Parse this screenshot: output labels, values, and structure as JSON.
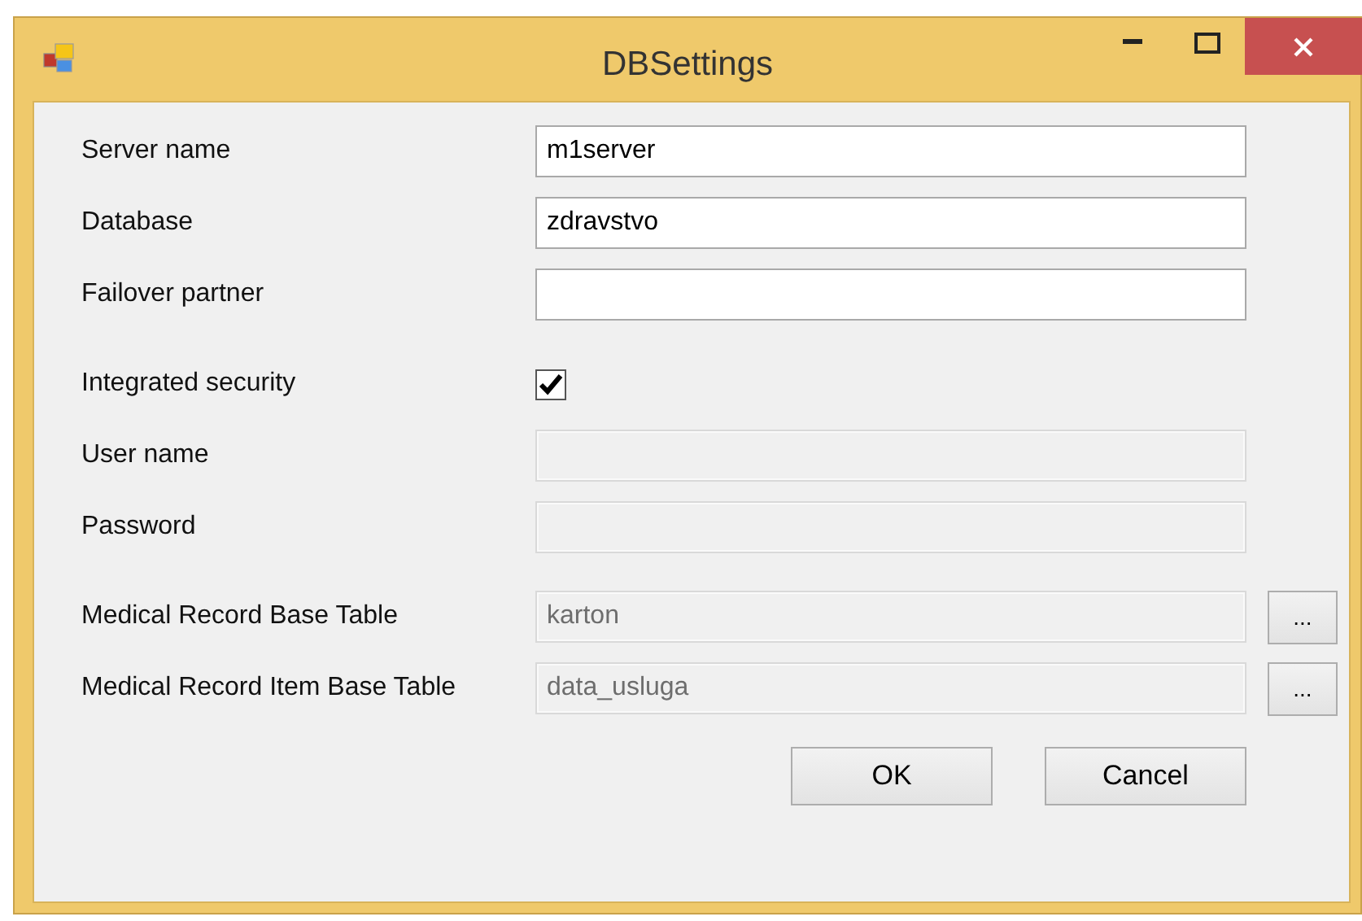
{
  "window": {
    "title": "DBSettings"
  },
  "sections": [
    [
      {
        "kind": "text",
        "label": "Server name",
        "value": "m1server",
        "disabled": false
      },
      {
        "kind": "text",
        "label": "Database",
        "value": "zdravstvo",
        "disabled": false
      },
      {
        "kind": "text",
        "label": "Failover partner",
        "disabled": false
      }
    ],
    [
      {
        "kind": "checkbox",
        "label": "Integrated security",
        "checked": true
      },
      {
        "kind": "text",
        "label": "User name",
        "disabled": true
      },
      {
        "kind": "text",
        "label": "Password",
        "disabled": true
      }
    ],
    [
      {
        "kind": "lookup",
        "label": "Medical Record Base Table",
        "value": "karton",
        "disabled": true,
        "button": "..."
      },
      {
        "kind": "lookup",
        "label": "Medical Record Item Base Table",
        "value": "data_usluga",
        "disabled": true,
        "button": "..."
      }
    ]
  ],
  "buttons": [
    "OK",
    "Cancel"
  ]
}
